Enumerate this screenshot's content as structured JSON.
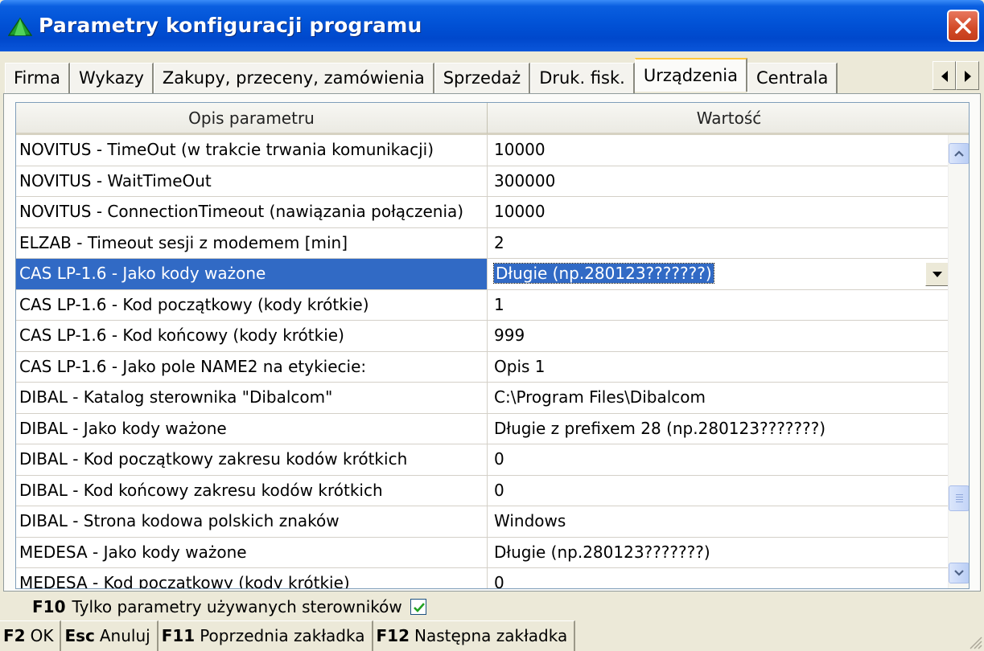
{
  "window": {
    "title": "Parametry konfiguracji programu",
    "icon": "green-triangle-app-icon",
    "close_icon": "close-icon",
    "accent_color": "#0152d6",
    "close_color": "#d24a27"
  },
  "tabs": [
    {
      "label": "Firma",
      "active": false
    },
    {
      "label": "Wykazy",
      "active": false
    },
    {
      "label": "Zakupy, przeceny, zamówienia",
      "active": false
    },
    {
      "label": "Sprzedaż",
      "active": false
    },
    {
      "label": "Druk. fisk.",
      "active": false
    },
    {
      "label": "Urządzenia",
      "active": true
    },
    {
      "label": "Centrala",
      "active": false
    }
  ],
  "grid": {
    "columns": [
      "Opis parametru",
      "Wartość"
    ],
    "selected_row": 4,
    "selection_color": "#316ac5",
    "rows": [
      {
        "desc": "NOVITUS - TimeOut (w trakcie trwania komunikacji)",
        "value": "10000"
      },
      {
        "desc": "NOVITUS - WaitTimeOut",
        "value": "300000"
      },
      {
        "desc": "NOVITUS - ConnectionTimeout (nawiązania połączenia)",
        "value": "10000"
      },
      {
        "desc": "ELZAB  - Timeout sesji z modemem [min]",
        "value": "2"
      },
      {
        "desc": "CAS LP-1.6 - Jako kody ważone",
        "value": "Długie (np.280123???????)"
      },
      {
        "desc": "CAS LP-1.6 - Kod początkowy (kody krótkie)",
        "value": "1"
      },
      {
        "desc": "CAS LP-1.6 - Kod końcowy (kody krótkie)",
        "value": "999"
      },
      {
        "desc": "CAS LP-1.6 - Jako pole NAME2 na etykiecie:",
        "value": "Opis 1"
      },
      {
        "desc": "DIBAL - Katalog sterownika \"Dibalcom\"",
        "value": "C:\\Program Files\\Dibalcom"
      },
      {
        "desc": "DIBAL - Jako kody ważone",
        "value": "Długie z prefixem 28 (np.280123???????)"
      },
      {
        "desc": "DIBAL - Kod początkowy zakresu kodów krótkich",
        "value": "0"
      },
      {
        "desc": "DIBAL - Kod końcowy zakresu kodów krótkich",
        "value": "0"
      },
      {
        "desc": "DIBAL - Strona kodowa polskich znaków",
        "value": "Windows"
      },
      {
        "desc": "MEDESA - Jako kody ważone",
        "value": "Długie (np.280123???????)"
      },
      {
        "desc": "MEDESA - Kod początkowy (kody krótkie)",
        "value": "0"
      }
    ]
  },
  "option": {
    "key": "F10",
    "label": "Tylko parametry używanych sterowników",
    "checked": true
  },
  "function_keys": [
    {
      "key": "F2",
      "label": "OK"
    },
    {
      "key": "Esc",
      "label": "Anuluj"
    },
    {
      "key": "F11",
      "label": "Poprzednia zakładka"
    },
    {
      "key": "F12",
      "label": "Następna zakładka"
    }
  ]
}
